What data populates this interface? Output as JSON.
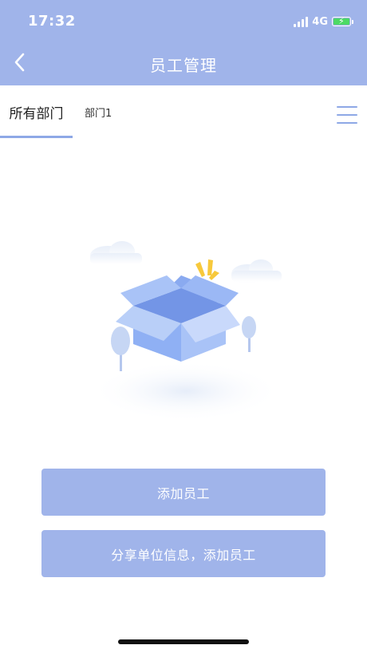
{
  "status_bar": {
    "time": "17:32",
    "network": "4G"
  },
  "header": {
    "title": "员工管理"
  },
  "tabs": [
    {
      "label": "所有部门",
      "active": true
    },
    {
      "label": "部门1",
      "active": false
    }
  ],
  "actions": {
    "add_employee": "添加员工",
    "share_info": "分享单位信息，添加员工"
  },
  "colors": {
    "brand": "#a0b4ea",
    "accent": "#8ea8e6",
    "battery": "#4cd964"
  },
  "icons": [
    "back-chevron-icon",
    "menu-icon",
    "empty-box-illustration"
  ]
}
